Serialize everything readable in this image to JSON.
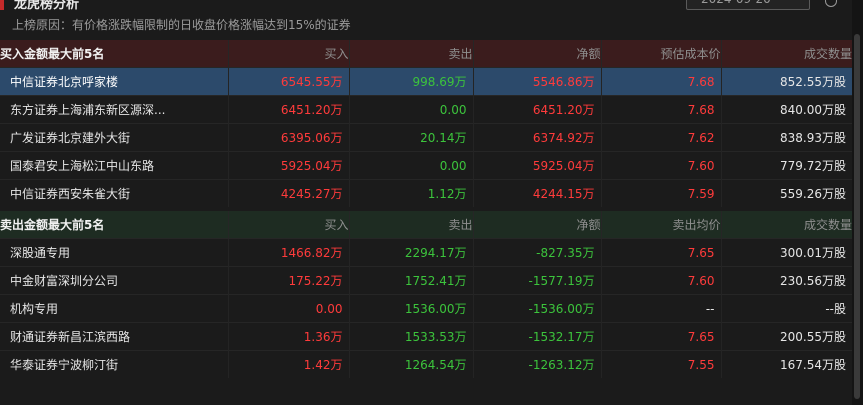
{
  "header": {
    "title": "龙虎榜分析",
    "date": "2024-09-20"
  },
  "reason_text": "上榜原因：有价格涨跌幅限制的日收盘价格涨幅达到15%的证券",
  "buy_section": {
    "title": "买入金额最大前5名",
    "columns": [
      "买入",
      "卖出",
      "净额",
      "预估成本价",
      "成交数量"
    ],
    "rows": [
      {
        "name": "中信证券北京呼家楼",
        "buy": "6545.55万",
        "sell": "998.69万",
        "net": "5546.86万",
        "price": "7.68",
        "volume": "852.55万股"
      },
      {
        "name": "东方证券上海浦东新区源深...",
        "buy": "6451.20万",
        "sell": "0.00",
        "net": "6451.20万",
        "price": "7.68",
        "volume": "840.00万股"
      },
      {
        "name": "广发证券北京建外大街",
        "buy": "6395.06万",
        "sell": "20.14万",
        "net": "6374.92万",
        "price": "7.62",
        "volume": "838.93万股"
      },
      {
        "name": "国泰君安上海松江中山东路",
        "buy": "5925.04万",
        "sell": "0.00",
        "net": "5925.04万",
        "price": "7.60",
        "volume": "779.72万股"
      },
      {
        "name": "中信证券西安朱雀大街",
        "buy": "4245.27万",
        "sell": "1.12万",
        "net": "4244.15万",
        "price": "7.59",
        "volume": "559.26万股"
      }
    ]
  },
  "sell_section": {
    "title": "卖出金额最大前5名",
    "columns": [
      "买入",
      "卖出",
      "净额",
      "卖出均价",
      "成交数量"
    ],
    "rows": [
      {
        "name": "深股通专用",
        "buy": "1466.82万",
        "sell": "2294.17万",
        "net": "-827.35万",
        "price": "7.65",
        "volume": "300.01万股"
      },
      {
        "name": "中金财富深圳分公司",
        "buy": "175.22万",
        "sell": "1752.41万",
        "net": "-1577.19万",
        "price": "7.60",
        "volume": "230.56万股"
      },
      {
        "name": "机构专用",
        "buy": "0.00",
        "sell": "1536.00万",
        "net": "-1536.00万",
        "price": "--",
        "volume": "--股"
      },
      {
        "name": "财通证券新昌江滨西路",
        "buy": "1.36万",
        "sell": "1533.53万",
        "net": "-1532.17万",
        "price": "7.65",
        "volume": "200.55万股"
      },
      {
        "name": "华泰证券宁波柳汀街",
        "buy": "1.42万",
        "sell": "1264.54万",
        "net": "-1263.12万",
        "price": "7.55",
        "volume": "167.54万股"
      }
    ]
  },
  "colors": {
    "up": "#ff3b3b",
    "down": "#3cc43c",
    "neutral": "#e6e6e6",
    "selected_row": "#2c4a6b",
    "buy_header": "#3b1c1d",
    "sell_header": "#1e2c22"
  }
}
